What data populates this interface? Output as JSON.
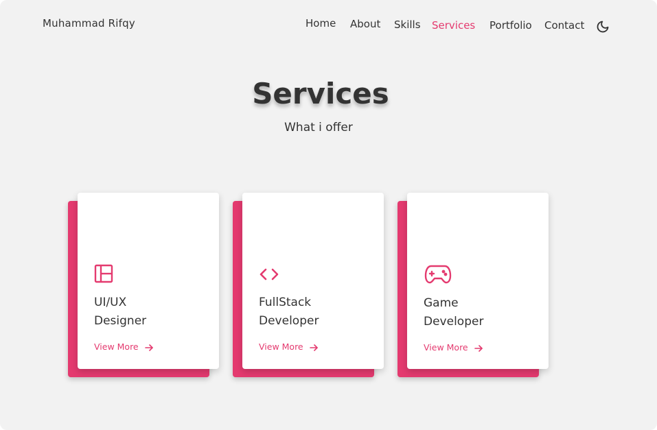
{
  "header": {
    "logo": "Muhammad Rifqy",
    "nav": [
      {
        "label": "Home"
      },
      {
        "label": "About"
      },
      {
        "label": "Skills"
      },
      {
        "label": "Services",
        "active": true
      },
      {
        "label": "Portfolio"
      },
      {
        "label": "Contact"
      }
    ],
    "theme_toggle_icon": "moon-icon"
  },
  "hero": {
    "title": "Services",
    "subtitle": "What i offer"
  },
  "services": [
    {
      "title_line1": "UI/UX",
      "title_line2": "Designer",
      "link": "View More",
      "icon": "layout-icon"
    },
    {
      "title_line1": "FullStack",
      "title_line2": "Developer",
      "link": "View More",
      "icon": "code-icon"
    },
    {
      "title_line1": "Game",
      "title_line2": "Developer",
      "link": "View More",
      "icon": "gamepad-icon"
    }
  ],
  "colors": {
    "accent": "#e43a6f",
    "background": "#f2f2f2",
    "text": "#333333",
    "card": "#ffffff"
  }
}
